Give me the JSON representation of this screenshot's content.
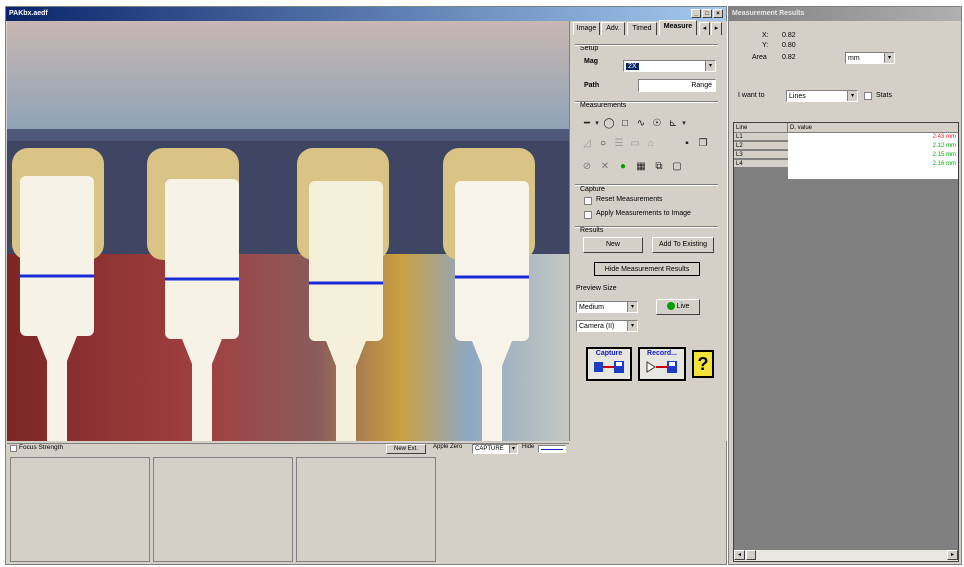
{
  "main_window": {
    "title": "PAKbx.aedf",
    "min_btn": "_",
    "max_btn": "□",
    "close_btn": "×"
  },
  "tabs": [
    {
      "label": "Image"
    },
    {
      "label": "Adv."
    },
    {
      "label": "Timed"
    },
    {
      "label": "Measure"
    },
    {
      "label": "◂"
    },
    {
      "label": "▸"
    }
  ],
  "setup": {
    "section": "Setup",
    "mag_label": "Mag",
    "mag_value": "2X",
    "path_label": "Path",
    "path_value": "Range"
  },
  "measurements": {
    "section": "Measurements",
    "row1": [
      "━",
      "▾",
      "◯",
      "□",
      "∿",
      "☉",
      "⊾",
      "▾"
    ],
    "row2": [
      "◿",
      "○",
      "☰",
      "▭",
      "⌂",
      "▪",
      "❐"
    ],
    "row3": [
      "⊘",
      "✕",
      "●",
      "▦",
      "⧉",
      "▢"
    ]
  },
  "capture": {
    "section": "Capture",
    "reset_label": "Reset Measurements",
    "apply_label": "Apply Measurements to Image"
  },
  "results_group": {
    "section": "Results",
    "new_button": "New",
    "add_button": "Add To Existing",
    "hide_button": "Hide Measurement Results"
  },
  "preview": {
    "section": "Preview Size",
    "size_value": "Medium",
    "camera_value": "Camera (II)",
    "live_button": "Live",
    "live_color": "#00a000"
  },
  "big_buttons": {
    "capture_label": "Capture",
    "record_label": "Record...",
    "help_label": "?"
  },
  "bottom_bar": {
    "focus_label": "Focus Strength",
    "new_ext_button": "New Ext.",
    "apple_zero_label": "Apple Zero",
    "capture_value": "CAPTURE",
    "hide_label": "Hide"
  },
  "results_window": {
    "title": "Measurement Results",
    "x_label": "X:",
    "x_value": "0.82",
    "y_label": "Y:",
    "y_value": "0.80",
    "area_label": "Area",
    "area_value": "0.82",
    "unit_value": "mm",
    "iwant_label": "I want to",
    "iwant_value": "Lines",
    "stats_label": "Stats",
    "table": {
      "headers": [
        "Line",
        "D. value"
      ],
      "rows": [
        {
          "line": "L1",
          "value": "2.43 mm",
          "color": "#ff2020"
        },
        {
          "line": "L2",
          "value": "2.12 mm",
          "color": "#00b000"
        },
        {
          "line": "L3",
          "value": "2.15 mm",
          "color": "#00b000"
        },
        {
          "line": "L4",
          "value": "2.16 mm",
          "color": "#00b000"
        }
      ]
    },
    "scroll_left": "◂",
    "scroll_right": "▸"
  },
  "accent": {
    "title_start": "#0a246a",
    "title_end": "#a6caf0",
    "measure_line": "#1a2adb"
  }
}
